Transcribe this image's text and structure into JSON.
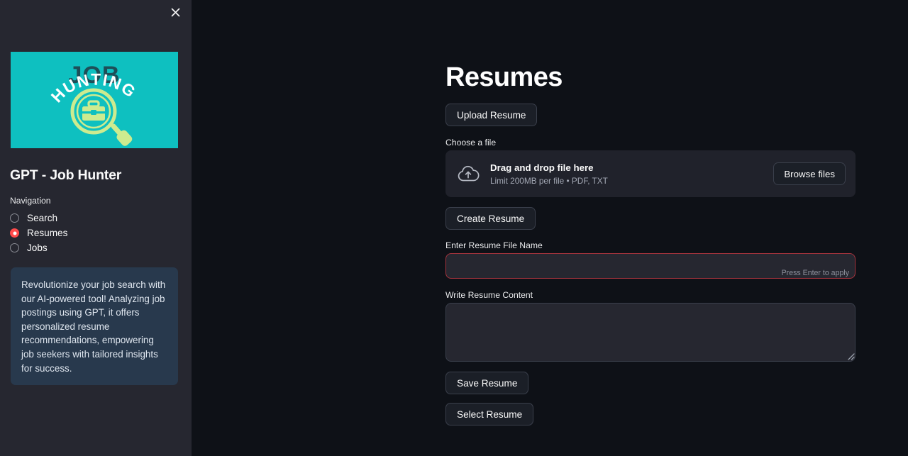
{
  "sidebar": {
    "close_icon": "close-icon",
    "logo": {
      "alt": "JOB HUNTING logo",
      "word_top": "JOB",
      "word_arc": "HUNTING",
      "bg_color": "#0ec0c0",
      "text_color": "#1d4f58",
      "arc_color": "#ffffff",
      "glass_color": "#cdeb8f"
    },
    "app_title": "GPT - Job Hunter",
    "nav_label": "Navigation",
    "nav_items": [
      {
        "label": "Search",
        "selected": false
      },
      {
        "label": "Resumes",
        "selected": true
      },
      {
        "label": "Jobs",
        "selected": false
      }
    ],
    "selected_color": "#ff4b4b",
    "info_box": {
      "text": "Revolutionize your job search with our AI-powered tool! Analyzing job postings using GPT, it offers personalized resume recommendations, empowering job seekers with tailored insights for success.",
      "bg_color": "#28394d"
    }
  },
  "main": {
    "page_title": "Resumes",
    "upload_resume_label": "Upload Resume",
    "choose_file_label": "Choose a file",
    "dropzone": {
      "icon": "cloud-upload-icon",
      "title": "Drag and drop file here",
      "subtitle": "Limit 200MB per file • PDF, TXT",
      "browse_label": "Browse files"
    },
    "create_resume_label": "Create Resume",
    "filename_field": {
      "label": "Enter Resume File Name",
      "value": "",
      "placeholder": "",
      "hint": "Press Enter to apply",
      "border_color": "#a4333d"
    },
    "content_field": {
      "label": "Write Resume Content",
      "value": "",
      "placeholder": ""
    },
    "save_resume_label": "Save Resume",
    "select_resume_label": "Select Resume"
  }
}
